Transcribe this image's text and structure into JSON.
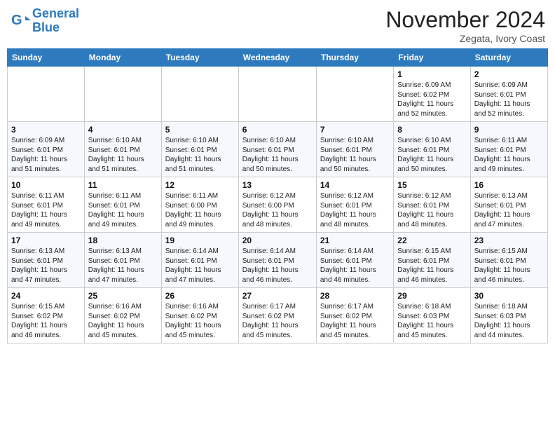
{
  "header": {
    "logo_line1": "General",
    "logo_line2": "Blue",
    "month_title": "November 2024",
    "location": "Zegata, Ivory Coast"
  },
  "weekdays": [
    "Sunday",
    "Monday",
    "Tuesday",
    "Wednesday",
    "Thursday",
    "Friday",
    "Saturday"
  ],
  "weeks": [
    [
      {
        "day": "",
        "info": ""
      },
      {
        "day": "",
        "info": ""
      },
      {
        "day": "",
        "info": ""
      },
      {
        "day": "",
        "info": ""
      },
      {
        "day": "",
        "info": ""
      },
      {
        "day": "1",
        "info": "Sunrise: 6:09 AM\nSunset: 6:02 PM\nDaylight: 11 hours\nand 52 minutes."
      },
      {
        "day": "2",
        "info": "Sunrise: 6:09 AM\nSunset: 6:01 PM\nDaylight: 11 hours\nand 52 minutes."
      }
    ],
    [
      {
        "day": "3",
        "info": "Sunrise: 6:09 AM\nSunset: 6:01 PM\nDaylight: 11 hours\nand 51 minutes."
      },
      {
        "day": "4",
        "info": "Sunrise: 6:10 AM\nSunset: 6:01 PM\nDaylight: 11 hours\nand 51 minutes."
      },
      {
        "day": "5",
        "info": "Sunrise: 6:10 AM\nSunset: 6:01 PM\nDaylight: 11 hours\nand 51 minutes."
      },
      {
        "day": "6",
        "info": "Sunrise: 6:10 AM\nSunset: 6:01 PM\nDaylight: 11 hours\nand 50 minutes."
      },
      {
        "day": "7",
        "info": "Sunrise: 6:10 AM\nSunset: 6:01 PM\nDaylight: 11 hours\nand 50 minutes."
      },
      {
        "day": "8",
        "info": "Sunrise: 6:10 AM\nSunset: 6:01 PM\nDaylight: 11 hours\nand 50 minutes."
      },
      {
        "day": "9",
        "info": "Sunrise: 6:11 AM\nSunset: 6:01 PM\nDaylight: 11 hours\nand 49 minutes."
      }
    ],
    [
      {
        "day": "10",
        "info": "Sunrise: 6:11 AM\nSunset: 6:01 PM\nDaylight: 11 hours\nand 49 minutes."
      },
      {
        "day": "11",
        "info": "Sunrise: 6:11 AM\nSunset: 6:01 PM\nDaylight: 11 hours\nand 49 minutes."
      },
      {
        "day": "12",
        "info": "Sunrise: 6:11 AM\nSunset: 6:00 PM\nDaylight: 11 hours\nand 49 minutes."
      },
      {
        "day": "13",
        "info": "Sunrise: 6:12 AM\nSunset: 6:00 PM\nDaylight: 11 hours\nand 48 minutes."
      },
      {
        "day": "14",
        "info": "Sunrise: 6:12 AM\nSunset: 6:01 PM\nDaylight: 11 hours\nand 48 minutes."
      },
      {
        "day": "15",
        "info": "Sunrise: 6:12 AM\nSunset: 6:01 PM\nDaylight: 11 hours\nand 48 minutes."
      },
      {
        "day": "16",
        "info": "Sunrise: 6:13 AM\nSunset: 6:01 PM\nDaylight: 11 hours\nand 47 minutes."
      }
    ],
    [
      {
        "day": "17",
        "info": "Sunrise: 6:13 AM\nSunset: 6:01 PM\nDaylight: 11 hours\nand 47 minutes."
      },
      {
        "day": "18",
        "info": "Sunrise: 6:13 AM\nSunset: 6:01 PM\nDaylight: 11 hours\nand 47 minutes."
      },
      {
        "day": "19",
        "info": "Sunrise: 6:14 AM\nSunset: 6:01 PM\nDaylight: 11 hours\nand 47 minutes."
      },
      {
        "day": "20",
        "info": "Sunrise: 6:14 AM\nSunset: 6:01 PM\nDaylight: 11 hours\nand 46 minutes."
      },
      {
        "day": "21",
        "info": "Sunrise: 6:14 AM\nSunset: 6:01 PM\nDaylight: 11 hours\nand 46 minutes."
      },
      {
        "day": "22",
        "info": "Sunrise: 6:15 AM\nSunset: 6:01 PM\nDaylight: 11 hours\nand 46 minutes."
      },
      {
        "day": "23",
        "info": "Sunrise: 6:15 AM\nSunset: 6:01 PM\nDaylight: 11 hours\nand 46 minutes."
      }
    ],
    [
      {
        "day": "24",
        "info": "Sunrise: 6:15 AM\nSunset: 6:02 PM\nDaylight: 11 hours\nand 46 minutes."
      },
      {
        "day": "25",
        "info": "Sunrise: 6:16 AM\nSunset: 6:02 PM\nDaylight: 11 hours\nand 45 minutes."
      },
      {
        "day": "26",
        "info": "Sunrise: 6:16 AM\nSunset: 6:02 PM\nDaylight: 11 hours\nand 45 minutes."
      },
      {
        "day": "27",
        "info": "Sunrise: 6:17 AM\nSunset: 6:02 PM\nDaylight: 11 hours\nand 45 minutes."
      },
      {
        "day": "28",
        "info": "Sunrise: 6:17 AM\nSunset: 6:02 PM\nDaylight: 11 hours\nand 45 minutes."
      },
      {
        "day": "29",
        "info": "Sunrise: 6:18 AM\nSunset: 6:03 PM\nDaylight: 11 hours\nand 45 minutes."
      },
      {
        "day": "30",
        "info": "Sunrise: 6:18 AM\nSunset: 6:03 PM\nDaylight: 11 hours\nand 44 minutes."
      }
    ]
  ]
}
